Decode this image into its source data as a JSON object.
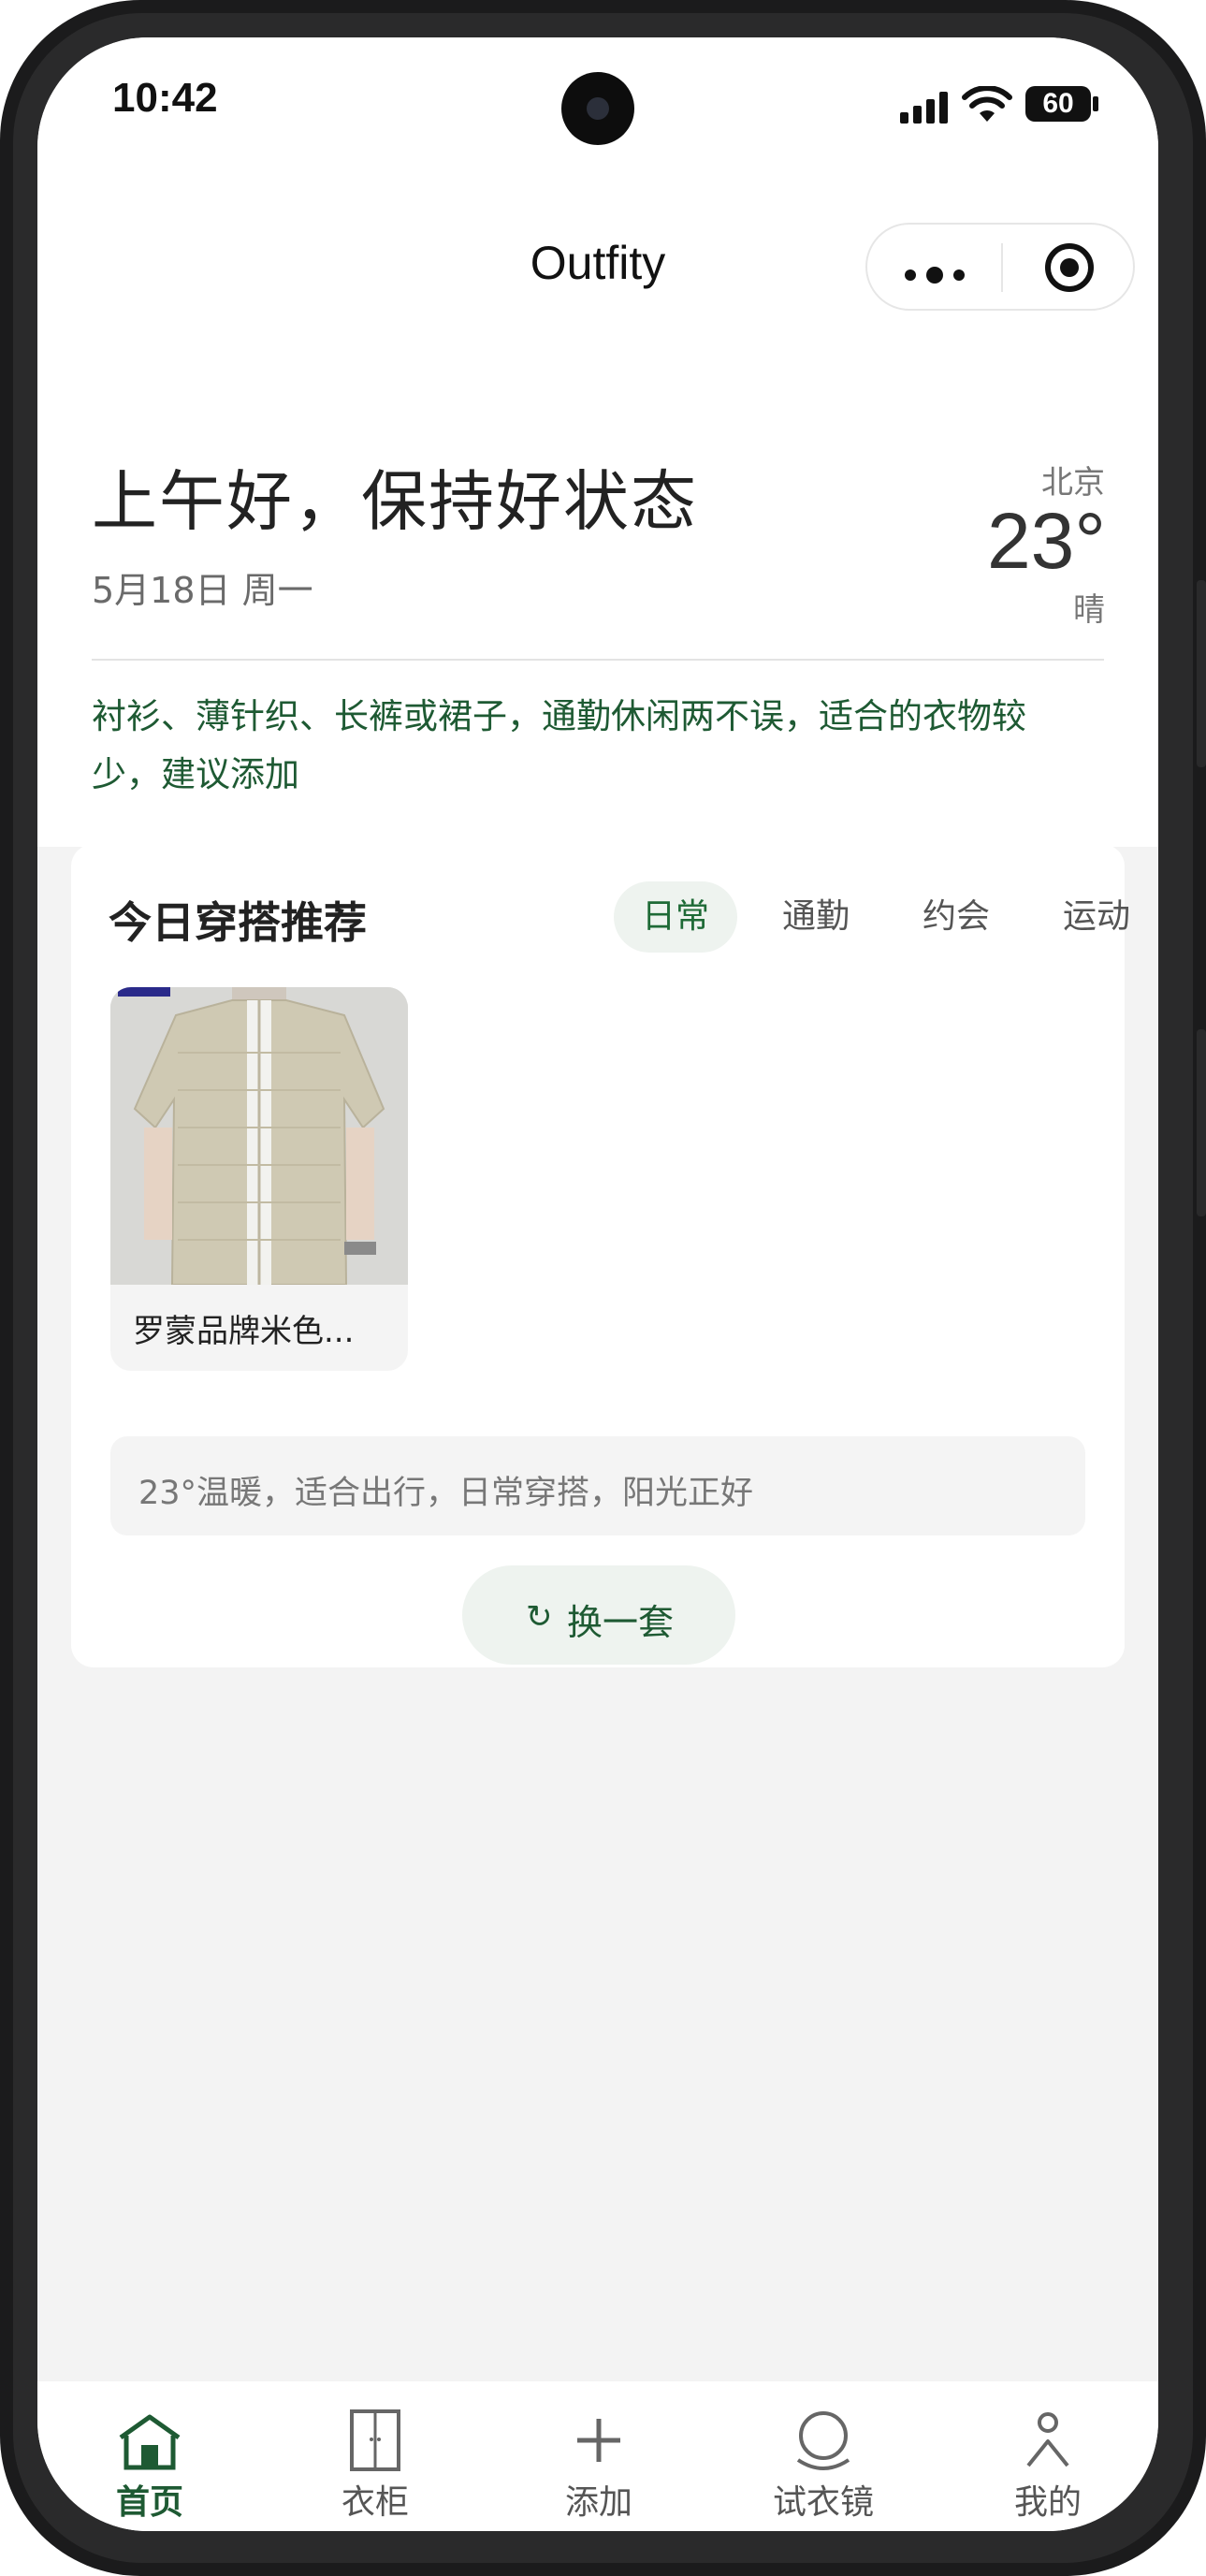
{
  "status_bar": {
    "time": "10:42",
    "battery": "60"
  },
  "nav": {
    "title": "Outfity"
  },
  "header": {
    "greeting": "上午好，保持好状态",
    "date": "5月18日 周一",
    "weather": {
      "city": "北京",
      "temperature": "23°",
      "condition": "晴"
    },
    "advice": "衬衫、薄针织、长裤或裙子，通勤休闲两不误，适合的衣物较少，建议添加"
  },
  "recommendation": {
    "title": "今日穿搭推荐",
    "tabs": [
      {
        "label": "日常",
        "active": true
      },
      {
        "label": "通勤",
        "active": false
      },
      {
        "label": "约会",
        "active": false
      },
      {
        "label": "运动",
        "active": false
      }
    ],
    "items": [
      {
        "name": "罗蒙品牌米色..."
      }
    ],
    "note": "23°温暖，适合出行，日常穿搭，阳光正好",
    "refresh_icon": "↻",
    "refresh_label": "换一套"
  },
  "tabbar": {
    "items": [
      {
        "label": "首页",
        "icon": "home-icon",
        "active": true
      },
      {
        "label": "衣柜",
        "icon": "wardrobe-icon",
        "active": false
      },
      {
        "label": "添加",
        "icon": "plus-icon",
        "active": false
      },
      {
        "label": "试衣镜",
        "icon": "mirror-icon",
        "active": false
      },
      {
        "label": "我的",
        "icon": "profile-icon",
        "active": false
      }
    ]
  },
  "colors": {
    "accent": "#1e5a33",
    "accent_bg": "#eef3ef",
    "page_bg": "#f3f3f3"
  }
}
